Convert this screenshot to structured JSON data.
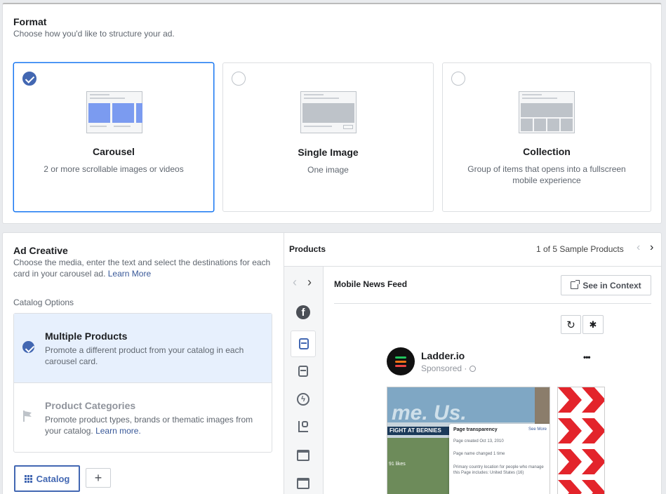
{
  "format": {
    "title": "Format",
    "subtitle": "Choose how you'd like to structure your ad.",
    "options": [
      {
        "label": "Carousel",
        "desc": "2 or more scrollable images or videos",
        "selected": true
      },
      {
        "label": "Single Image",
        "desc": "One image",
        "selected": false
      },
      {
        "label": "Collection",
        "desc": "Group of items that opens into a fullscreen mobile experience",
        "selected": false
      }
    ]
  },
  "creative": {
    "title": "Ad Creative",
    "desc": "Choose the media, enter the text and select the destinations for each card in your carousel ad.",
    "learn_more": "Learn More",
    "catalog_label": "Catalog Options",
    "options": [
      {
        "title": "Multiple Products",
        "desc": "Promote a different product from your catalog in each carousel card.",
        "selected": true
      },
      {
        "title": "Product Categories",
        "desc": "Promote product types, brands or thematic images from your catalog.",
        "link": "Learn more.",
        "selected": false
      }
    ],
    "catalog_button": "Catalog",
    "add_button": "+"
  },
  "preview": {
    "products_label": "Products",
    "sample_count": "1 of 5 Sample Products",
    "placement": "Mobile News Feed",
    "see_context": "See in Context",
    "page_name": "Ladder.io",
    "sponsored": "Sponsored ·",
    "more": "•••",
    "card1": {
      "headline": "me. Us.",
      "fight": "FIGHT AT BERNIES",
      "likes": "91 likes",
      "transparency_title": "Page transparency",
      "see_more": "See More",
      "created": "Page created Oct 13, 2010",
      "name_changed": "Page name changed 1 time",
      "country": "Primary country location for people who manage this Page includes: United States (16)"
    }
  },
  "colors": {
    "accent": "#4267b2",
    "selected_bg": "#e7f0fd",
    "link": "#385898"
  }
}
